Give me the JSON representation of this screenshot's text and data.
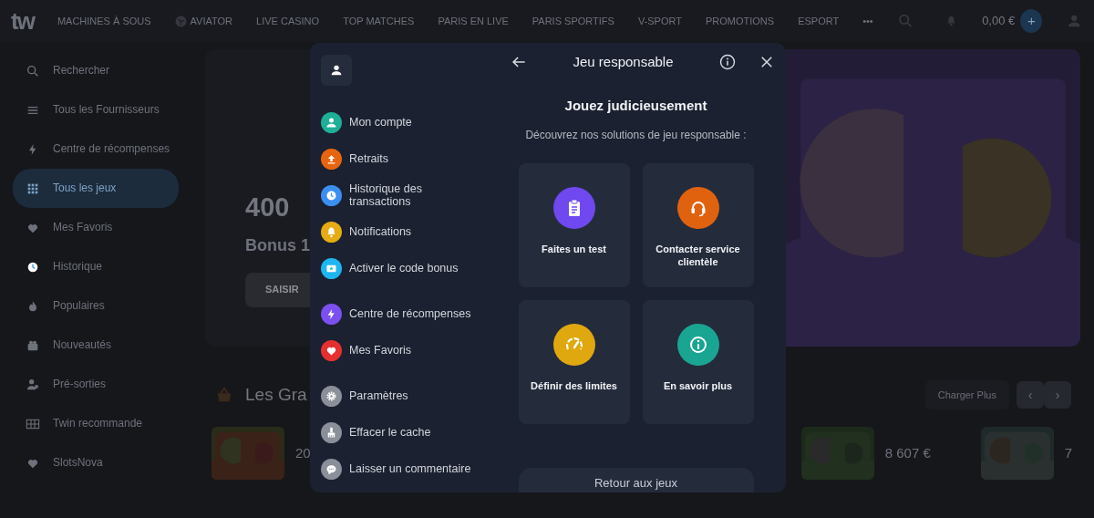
{
  "top_nav": {
    "logo": "tw",
    "items": [
      {
        "label": "MACHINES À SOUS",
        "kind": "text"
      },
      {
        "label": "AVIATOR",
        "kind": "icon"
      },
      {
        "label": "LIVE CASINO",
        "kind": "text"
      },
      {
        "label": "TOP MATCHES",
        "kind": "text"
      },
      {
        "label": "PARIS EN LIVE",
        "kind": "text"
      },
      {
        "label": "PARIS SPORTIFS",
        "kind": "text"
      },
      {
        "label": "V-SPORT",
        "kind": "text"
      },
      {
        "label": "PROMOTIONS",
        "kind": "text"
      },
      {
        "label": "ESPORT",
        "kind": "text"
      },
      {
        "label": "•••",
        "kind": "text"
      }
    ],
    "balance": "0,00 €",
    "deposit": "+"
  },
  "sidebar": {
    "items": [
      {
        "label": "Rechercher",
        "kind": "search",
        "selected": false
      },
      {
        "label": "Tous les Fournisseurs",
        "kind": "list",
        "selected": false
      },
      {
        "label": "Centre de récompenses",
        "kind": "bolt",
        "selected": false
      },
      {
        "label": "Tous les jeux",
        "kind": "grid",
        "selected": true
      },
      {
        "label": "Mes Favoris",
        "kind": "heart",
        "selected": false
      },
      {
        "label": "Historique",
        "kind": "clock",
        "selected": false
      },
      {
        "label": "Populaires",
        "kind": "fire",
        "selected": false
      },
      {
        "label": "Nouveautés",
        "kind": "gift",
        "selected": false
      },
      {
        "label": "Pré-sorties",
        "kind": "person",
        "selected": false
      },
      {
        "label": "Twin recommande",
        "kind": "table",
        "selected": false
      },
      {
        "label": "SlotsNova",
        "kind": "heart",
        "selected": false
      }
    ]
  },
  "banner": {
    "amount": "400",
    "subtitle": "Bonus 1",
    "button": "SAISIR"
  },
  "section": {
    "title": "Les Gra",
    "load_more": "Charger Plus",
    "prev": "‹",
    "next": "›",
    "games": [
      {
        "amount": "20"
      },
      {
        "amount": "8 607 €"
      },
      {
        "amount": "7"
      }
    ]
  },
  "modal": {
    "menu_groups": [
      [
        {
          "label": "Mon compte",
          "kind": "user",
          "color": "#1fae98"
        },
        {
          "label": "Retraits",
          "kind": "upload",
          "color": "#e8650f"
        },
        {
          "label": "Historique des transactions",
          "kind": "clock",
          "color": "#3b8ff0"
        },
        {
          "label": "Notifications",
          "kind": "bell",
          "color": "#e6ac12"
        },
        {
          "label": "Activer le code bonus",
          "kind": "ticket",
          "color": "#1fb6f0"
        }
      ],
      [
        {
          "label": "Centre de récompenses",
          "kind": "bolt",
          "color": "#7b4ff0"
        },
        {
          "label": "Mes Favoris",
          "kind": "heart",
          "color": "#e5302f"
        }
      ],
      [
        {
          "label": "Paramètres",
          "kind": "gear",
          "color": "#8a8f99"
        },
        {
          "label": "Effacer le cache",
          "kind": "broom",
          "color": "#8a8f99"
        },
        {
          "label": "Laisser un commentaire",
          "kind": "chat",
          "color": "#8a8f99"
        }
      ]
    ],
    "title": "Jeu responsable",
    "heading": "Jouez judicieusement",
    "subtitle": "Découvrez nos solutions de jeu responsable :",
    "options": [
      {
        "label": "Faites un test",
        "kind": "clipboard",
        "color": "#7048ef"
      },
      {
        "label": "Contacter service clientèle",
        "kind": "headset",
        "color": "#e0620f"
      },
      {
        "label": "Définir des limites",
        "kind": "gauge",
        "color": "#e0a80f"
      },
      {
        "label": "En savoir plus",
        "kind": "info",
        "color": "#1aa593"
      }
    ],
    "button": "Retour aux jeux"
  }
}
